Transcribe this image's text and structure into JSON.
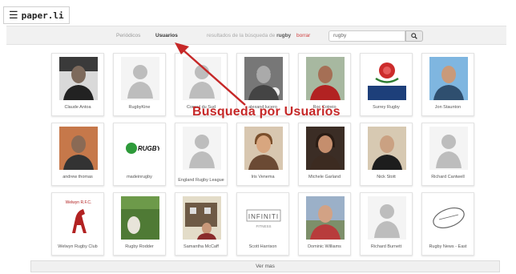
{
  "app": {
    "logo_text": "paper.li",
    "menu_icon": "hamburger-icon"
  },
  "searchbar": {
    "tab_periodicos": "Periódicos",
    "tab_usuarios": "Usuarios",
    "results_prefix": "resultados de la búsqueda de",
    "results_term": "rugby",
    "borrar": "borrar",
    "search_value": "rugby",
    "search_icon": "search-icon"
  },
  "annotation": {
    "text": "Busqueda por Usuarios",
    "color": "#c62828"
  },
  "users": [
    {
      "name": "Claude Antoa",
      "photo": "man-dark-tie"
    },
    {
      "name": "RugbyKine",
      "photo": "default-avatar"
    },
    {
      "name": "Consul du Sud",
      "photo": "default-avatar"
    },
    {
      "name": "alexand lucero",
      "photo": "bw-man-sunglasses"
    },
    {
      "name": "Roc Cotreio",
      "photo": "rugby-player-red"
    },
    {
      "name": "Surrey Rugby",
      "photo": "england-rose"
    },
    {
      "name": "Jon Staunton",
      "photo": "man-blue-sky"
    },
    {
      "name": "andrew thomas",
      "photo": "man-sunset"
    },
    {
      "name": "madeinrugby",
      "photo": "made-in-rugby-logo",
      "logo_text": "RUGBY"
    },
    {
      "name": "England Rugby League",
      "photo": "default-avatar"
    },
    {
      "name": "Iris Venema",
      "photo": "woman-smiling"
    },
    {
      "name": "Michele Garland",
      "photo": "woman-dark"
    },
    {
      "name": "Nick Stott",
      "photo": "man-suit"
    },
    {
      "name": "Richard Cantwell",
      "photo": "default-avatar"
    },
    {
      "name": "Welwyn Rugby Club",
      "photo": "welwyn-crest",
      "logo_text": "Welwyn R.F.C."
    },
    {
      "name": "Rugby Rodder",
      "photo": "rugby-ball-grass"
    },
    {
      "name": "Samantha McCaff",
      "photo": "house-woman"
    },
    {
      "name": "Scott Harrison",
      "photo": "infiniti-logo",
      "logo_text": "INFINITI",
      "logo_sub": "FITNESS"
    },
    {
      "name": "Dominic Williams",
      "photo": "crowd-outdoor"
    },
    {
      "name": "Richard Burnett",
      "photo": "default-avatar"
    },
    {
      "name": "Rugby News - East",
      "photo": "rugby-ball-drawing"
    }
  ],
  "footer": {
    "ver_mas": "Ver mas"
  }
}
